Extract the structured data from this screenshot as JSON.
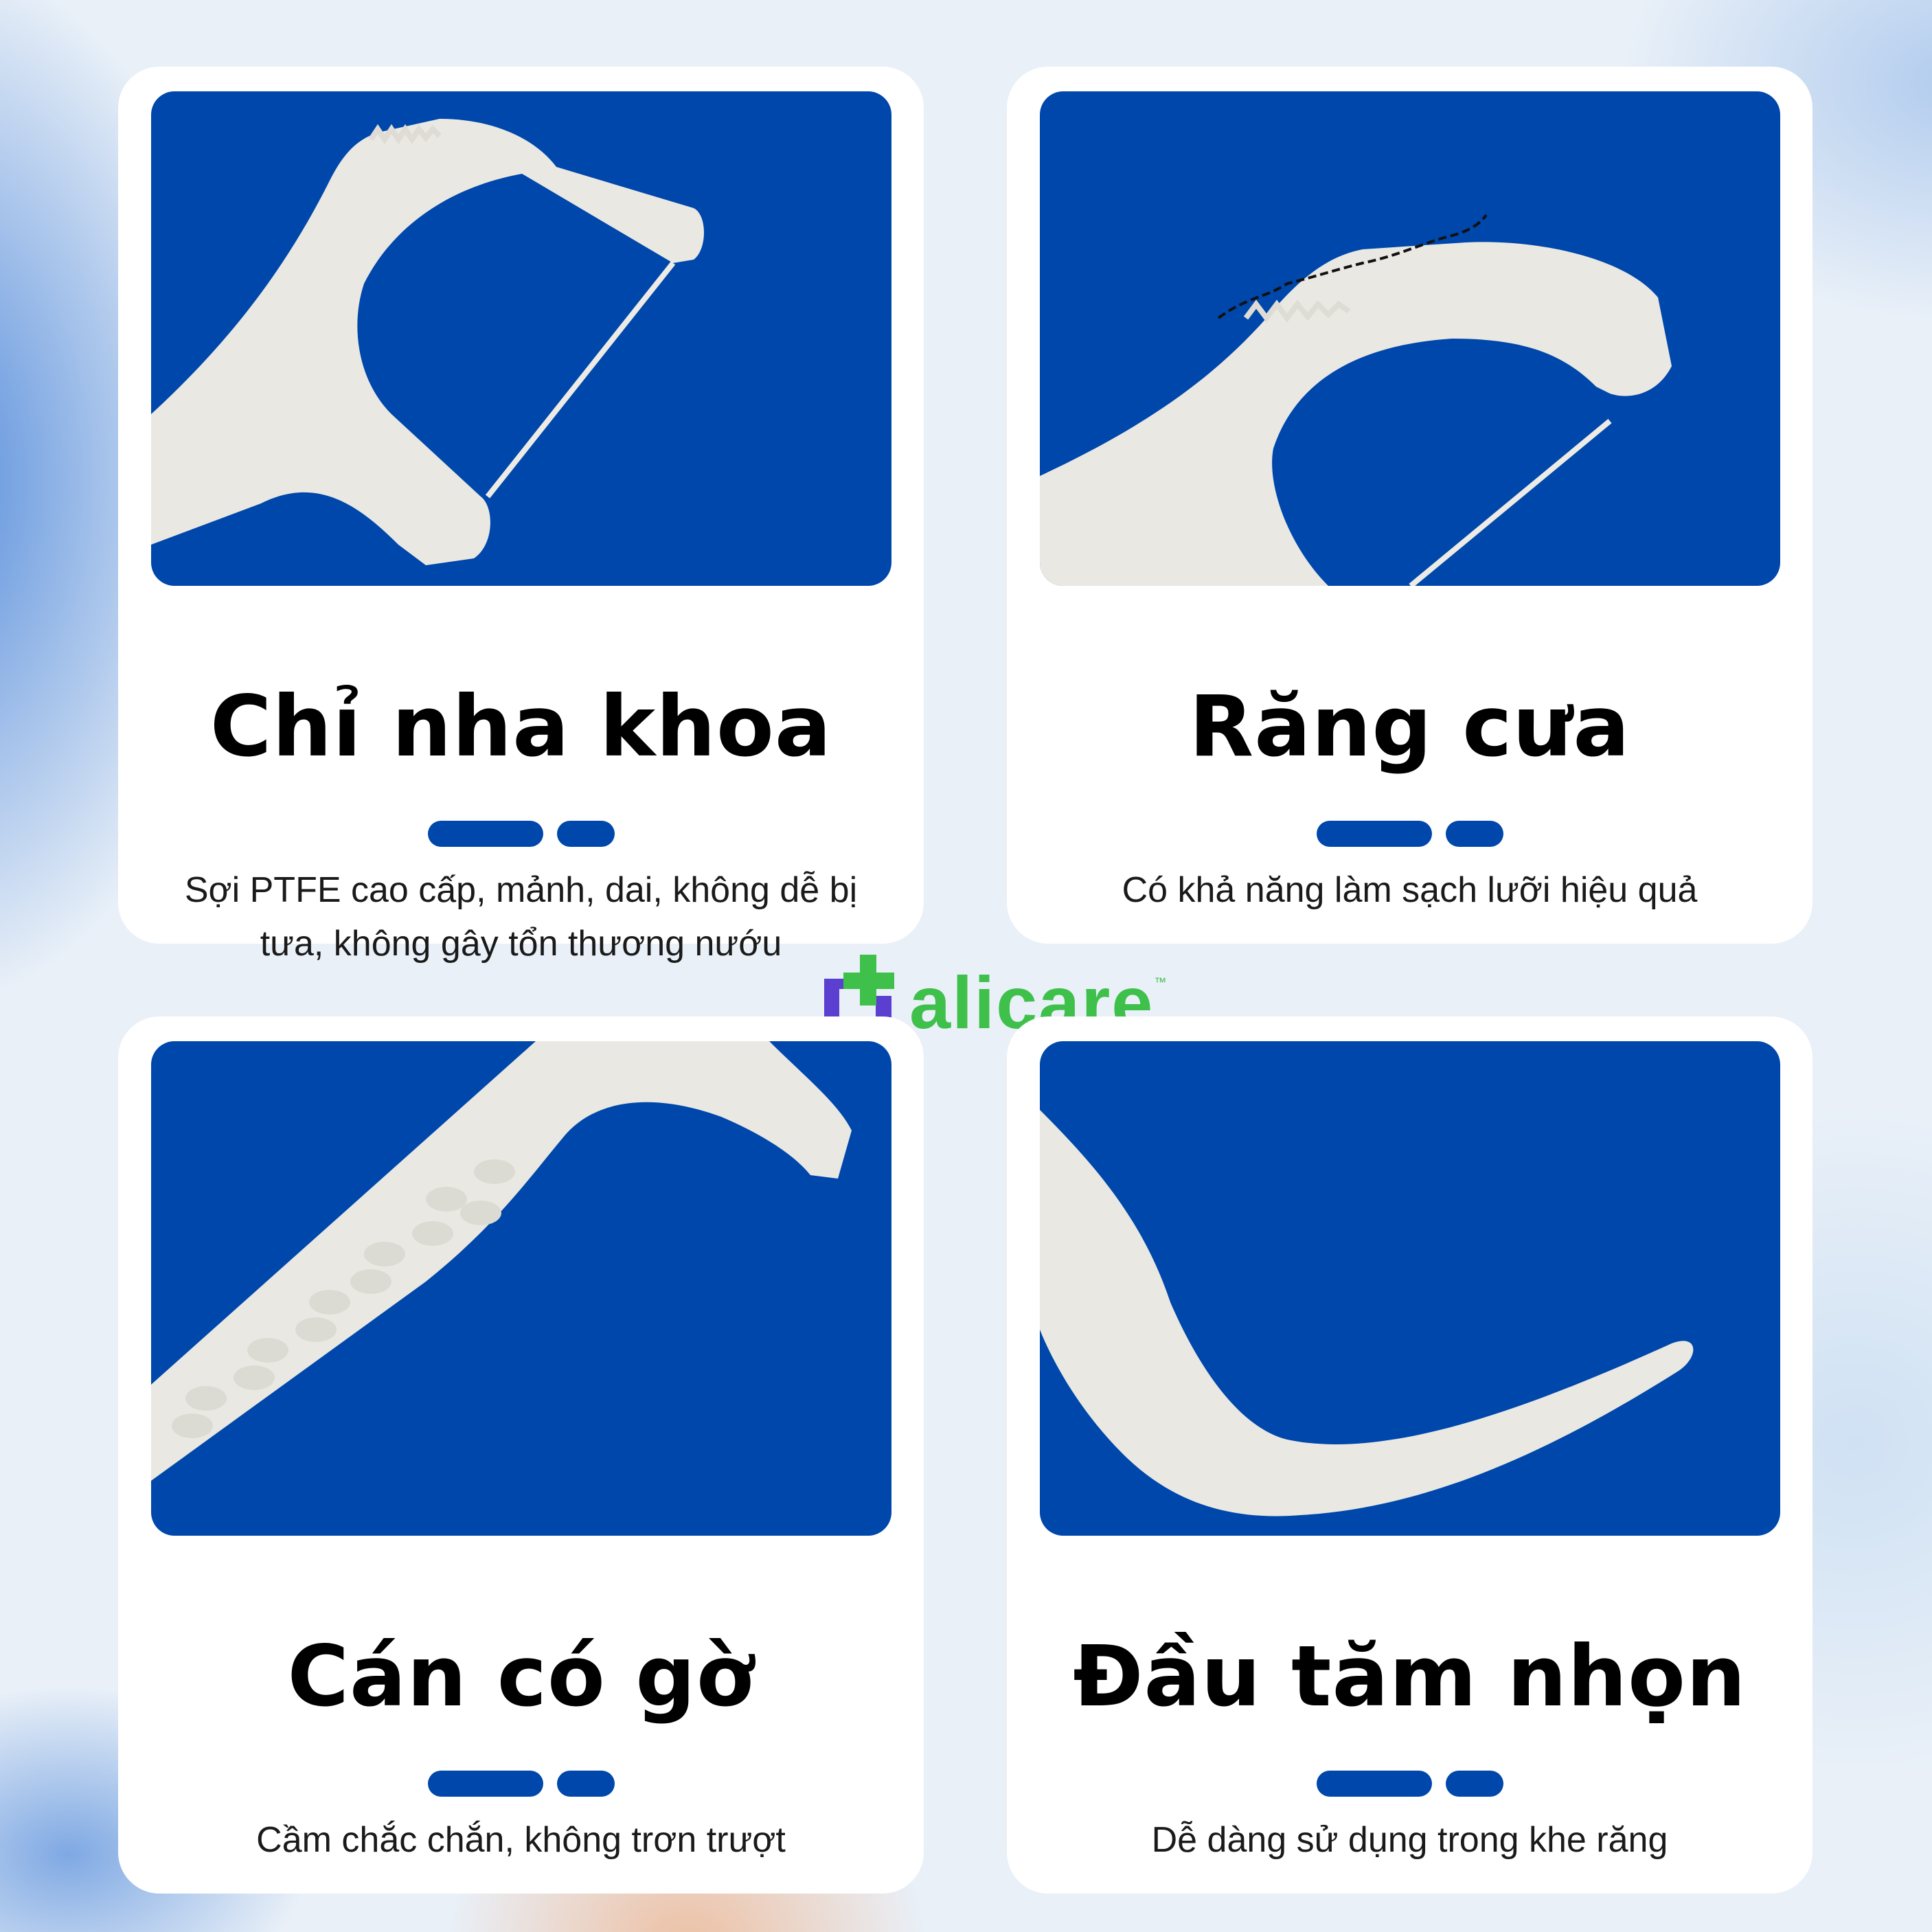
{
  "brand": {
    "name": "alicare",
    "trademark": "™",
    "colors": {
      "blue": "#0047ab",
      "green": "#3fc04b",
      "purple": "#5a3fd0"
    }
  },
  "features": [
    {
      "title": "Chỉ nha khoa",
      "description": "Sợi PTFE cao cấp, mảnh, dai, không dễ bị tưa, không gây tổn thương nướu",
      "image": "floss-pick-string-closeup"
    },
    {
      "title": "Răng cưa",
      "description": "Có khả năng làm sạch lưỡi hiệu quả",
      "image": "floss-pick-serrated-edge-closeup"
    },
    {
      "title": "Cán có gờ",
      "description": "Cầm chắc chắn, không trơn trượt",
      "image": "floss-pick-ridged-handle-closeup"
    },
    {
      "title": "Đầu tăm nhọn",
      "description": "Dễ dàng sử dụng trong khe răng",
      "image": "floss-pick-pointed-tip-closeup"
    }
  ]
}
